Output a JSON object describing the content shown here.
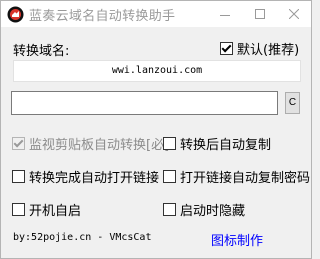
{
  "window": {
    "title": "蓝奏云域名自动转换助手"
  },
  "domain": {
    "label": "转换域名:",
    "default_checkbox": {
      "label": "默认(推荐)",
      "checked": true
    },
    "value": "wwi.lanzoui.com"
  },
  "url_input": {
    "value": ""
  },
  "c_button": {
    "label": "C"
  },
  "options": {
    "monitor_clipboard": {
      "label": "监视剪贴板自动转换[必]",
      "checked": true,
      "disabled": true
    },
    "copy_after_convert": {
      "label": "转换后自动复制",
      "checked": false
    },
    "open_link_after_convert": {
      "label": "转换完成自动打开链接",
      "checked": false
    },
    "copy_password_on_open": {
      "label": "打开链接自动复制密码",
      "checked": false
    },
    "autostart": {
      "label": "开机自启",
      "checked": false
    },
    "hide_on_start": {
      "label": "启动时隐藏",
      "checked": false
    }
  },
  "footer": {
    "credit": "by:52pojie.cn - VMcsCat",
    "icon_link": "图标制作"
  },
  "icons": {
    "app": "lanzou-cloud-icon",
    "minimize": "minimize-icon",
    "maximize": "maximize-icon",
    "close": "close-icon"
  },
  "colors": {
    "link": "#0000ff",
    "titlebar": "#ffffff",
    "window_bg": "#f0f0f0"
  }
}
